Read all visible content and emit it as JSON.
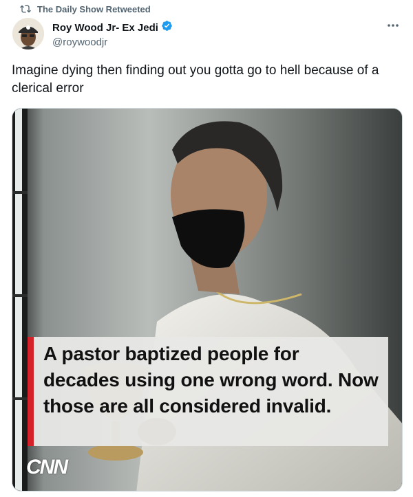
{
  "retweet": {
    "label": "The Daily Show Retweeted",
    "icon": "retweet-icon"
  },
  "author": {
    "display_name": "Roy Wood Jr- Ex Jedi",
    "handle": "@roywoodjr",
    "verified": true,
    "verified_icon": "verified-badge-icon"
  },
  "more_icon": "more-options-icon",
  "tweet": {
    "text": "Imagine dying then finding out you gotta go to hell because of a clerical error"
  },
  "media": {
    "caption": "A pastor baptized people for decades using one wrong word. Now those are all considered invalid.",
    "logo": "CNN",
    "accent_color": "#d3222a"
  },
  "colors": {
    "verified": "#1d9bf0",
    "secondary_text": "#536471",
    "primary_text": "#0f1419"
  }
}
